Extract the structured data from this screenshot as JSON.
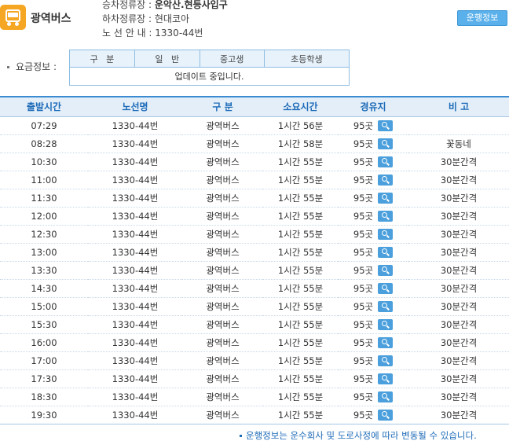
{
  "header": {
    "bus_icon": "bus-icon",
    "bus_type": "광역버스",
    "boarding_label": "승차정류장 : ",
    "boarding_stop": "운악산.현등사입구",
    "alighting_label": "하차정류장 : ",
    "alighting_stop": "현대코아",
    "route_label": "노 선 안 내 : ",
    "route": "1330-44번",
    "ops_button": "운행정보"
  },
  "fare": {
    "label": "요금정보 :",
    "headers": [
      "구   분",
      "일   반",
      "중고생",
      "초등학생"
    ],
    "message": "업데이트 중입니다."
  },
  "schedule": {
    "headers": [
      "출발시간",
      "노선명",
      "구 분",
      "소요시간",
      "경유지",
      "비 고"
    ],
    "rows": [
      {
        "time": "07:29",
        "route": "1330-44번",
        "type": "광역버스",
        "duration": "1시간 56분",
        "stops": "95곳",
        "note": ""
      },
      {
        "time": "08:28",
        "route": "1330-44번",
        "type": "광역버스",
        "duration": "1시간 58분",
        "stops": "95곳",
        "note": "꽃동네"
      },
      {
        "time": "10:30",
        "route": "1330-44번",
        "type": "광역버스",
        "duration": "1시간 55분",
        "stops": "95곳",
        "note": "30분간격"
      },
      {
        "time": "11:00",
        "route": "1330-44번",
        "type": "광역버스",
        "duration": "1시간 55분",
        "stops": "95곳",
        "note": "30분간격"
      },
      {
        "time": "11:30",
        "route": "1330-44번",
        "type": "광역버스",
        "duration": "1시간 55분",
        "stops": "95곳",
        "note": "30분간격"
      },
      {
        "time": "12:00",
        "route": "1330-44번",
        "type": "광역버스",
        "duration": "1시간 55분",
        "stops": "95곳",
        "note": "30분간격"
      },
      {
        "time": "12:30",
        "route": "1330-44번",
        "type": "광역버스",
        "duration": "1시간 55분",
        "stops": "95곳",
        "note": "30분간격"
      },
      {
        "time": "13:00",
        "route": "1330-44번",
        "type": "광역버스",
        "duration": "1시간 55분",
        "stops": "95곳",
        "note": "30분간격"
      },
      {
        "time": "13:30",
        "route": "1330-44번",
        "type": "광역버스",
        "duration": "1시간 55분",
        "stops": "95곳",
        "note": "30분간격"
      },
      {
        "time": "14:30",
        "route": "1330-44번",
        "type": "광역버스",
        "duration": "1시간 55분",
        "stops": "95곳",
        "note": "30분간격"
      },
      {
        "time": "15:00",
        "route": "1330-44번",
        "type": "광역버스",
        "duration": "1시간 55분",
        "stops": "95곳",
        "note": "30분간격"
      },
      {
        "time": "15:30",
        "route": "1330-44번",
        "type": "광역버스",
        "duration": "1시간 55분",
        "stops": "95곳",
        "note": "30분간격"
      },
      {
        "time": "16:00",
        "route": "1330-44번",
        "type": "광역버스",
        "duration": "1시간 55분",
        "stops": "95곳",
        "note": "30분간격"
      },
      {
        "time": "17:00",
        "route": "1330-44번",
        "type": "광역버스",
        "duration": "1시간 55분",
        "stops": "95곳",
        "note": "30분간격"
      },
      {
        "time": "17:30",
        "route": "1330-44번",
        "type": "광역버스",
        "duration": "1시간 55분",
        "stops": "95곳",
        "note": "30분간격"
      },
      {
        "time": "18:30",
        "route": "1330-44번",
        "type": "광역버스",
        "duration": "1시간 55분",
        "stops": "95곳",
        "note": "30분간격"
      },
      {
        "time": "19:30",
        "route": "1330-44번",
        "type": "광역버스",
        "duration": "1시간 55분",
        "stops": "95곳",
        "note": "30분간격"
      }
    ],
    "search_icon": "search-icon"
  },
  "notice": "운행정보는 운수회사 및 도로사정에 따라 변동될 수 있습니다.",
  "colors": {
    "accent": "#3a8bd1",
    "header_bg": "#e3eef8",
    "header_text": "#1e6bb8",
    "bus_icon": "#f5a623",
    "button": "#5ab0ea"
  }
}
